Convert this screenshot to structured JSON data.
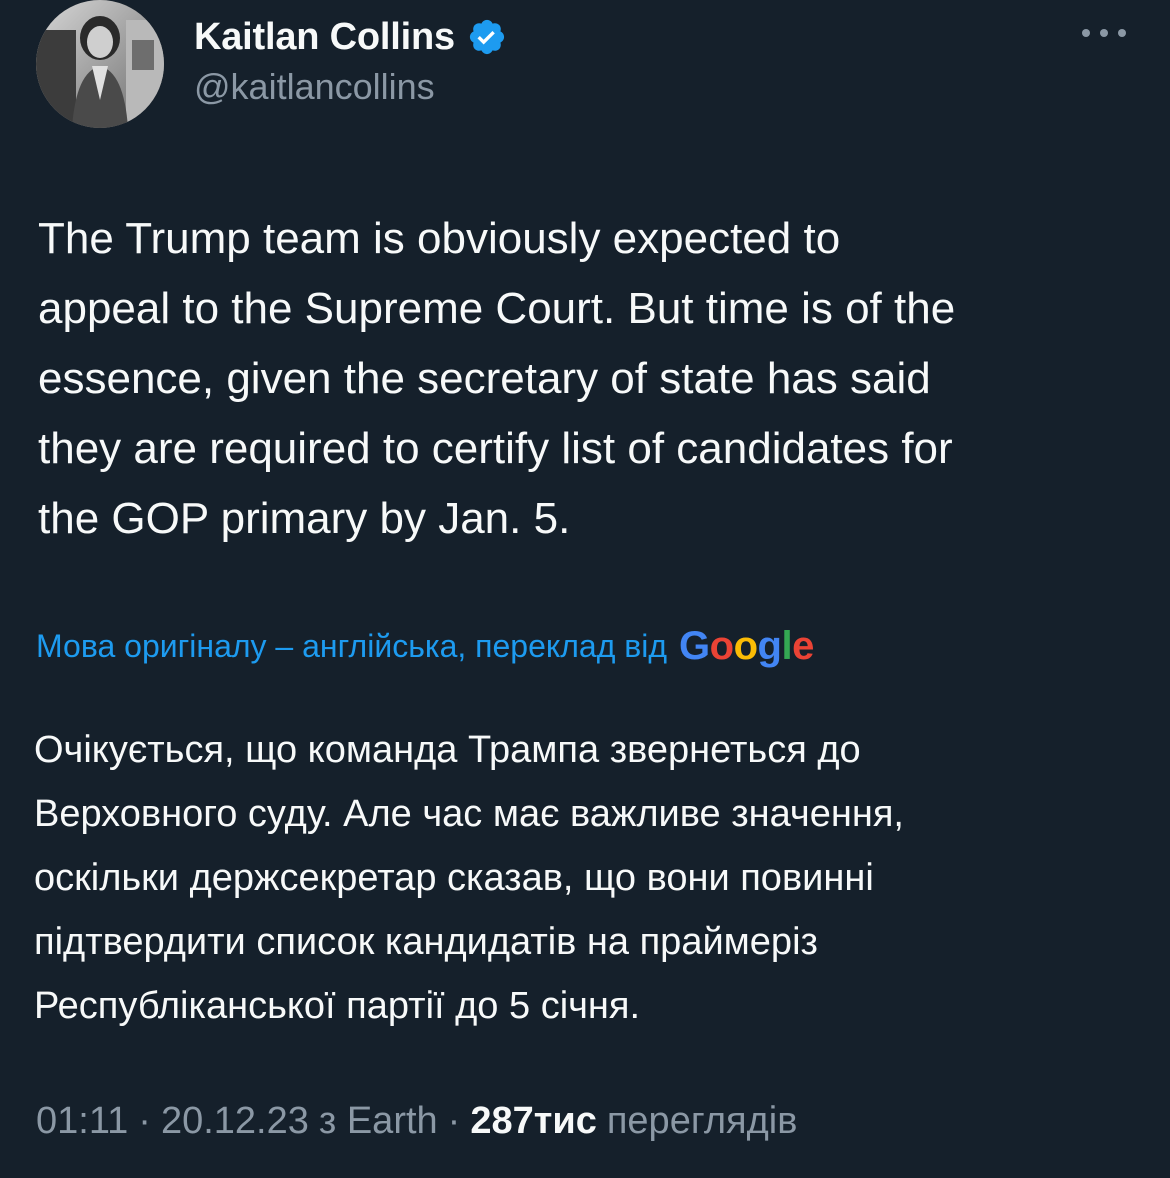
{
  "author": {
    "display_name": "Kaitlan Collins",
    "handle": "@kaitlancollins",
    "verified": true
  },
  "more_icon": "more-horizontal-icon",
  "tweet": {
    "text": "The Trump team is obviously expected to\nappeal to the Supreme Court. But time is of the\nessence, given the secretary of state has said\nthey are required to certify list of candidates for\nthe GOP primary by Jan. 5."
  },
  "translation": {
    "label": "Мова оригіналу – англійська, переклад від",
    "provider": "Google",
    "text": "Очікується, що команда Трампа звернеться до\nВерховного суду. Але час має важливе значення,\nоскільки держсекретар сказав, що вони повинні\nпідтвердити список кандидатів на праймеріз\nРеспубліканської партії до 5 січня."
  },
  "meta": {
    "time": "01:11",
    "date": "20.12.23",
    "source": "з Earth",
    "views_count": "287тис",
    "views_label": "переглядів",
    "separator": "·"
  },
  "colors": {
    "background": "#15202b",
    "text": "#f7f9f9",
    "secondary": "#8b98a5",
    "link": "#1d9bf0",
    "verified": "#1d9bf0"
  }
}
